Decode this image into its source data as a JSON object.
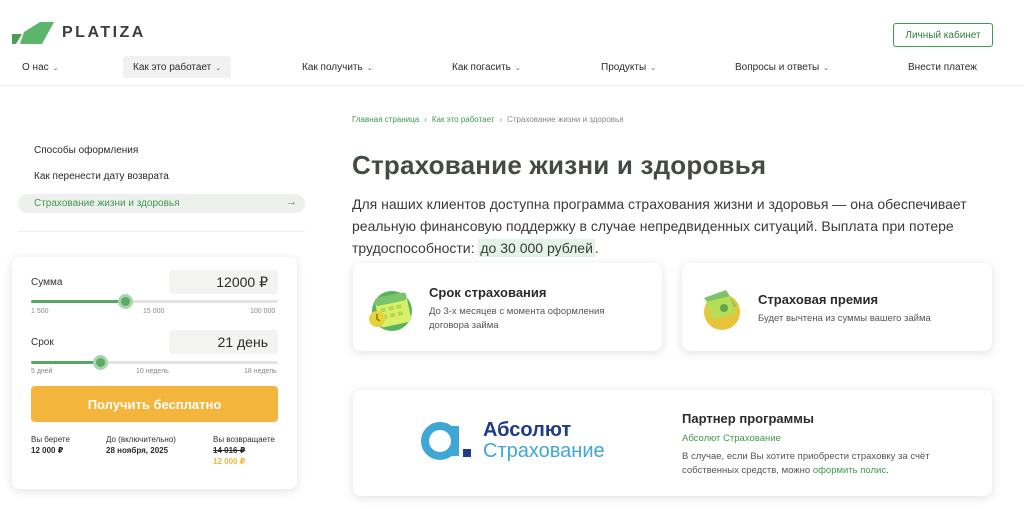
{
  "header": {
    "logo_text": "PLATIZA",
    "cabinet_button": "Личный кабинет",
    "colors": {
      "brand_green": "#3d9a4f",
      "accent_orange": "#f4b53d"
    }
  },
  "nav": {
    "items": [
      {
        "label": "О нас"
      },
      {
        "label": "Как это работает"
      },
      {
        "label": "Как получить"
      },
      {
        "label": "Как погасить"
      },
      {
        "label": "Продукты"
      },
      {
        "label": "Вопросы и ответы"
      },
      {
        "label": "Внести платеж"
      }
    ]
  },
  "sidebar": {
    "items": [
      {
        "label": "Способы оформления"
      },
      {
        "label": "Как перенести дату возврата"
      },
      {
        "label": "Страхование жизни и здоровья"
      }
    ]
  },
  "calculator": {
    "amount_label": "Сумма",
    "amount_value": "12000 ₽",
    "amount_fraction": 0.38,
    "amount_ticks": [
      "1 500",
      "15 000",
      "100 000"
    ],
    "term_label": "Срок",
    "term_value": "21 день",
    "term_fraction": 0.28,
    "term_ticks": [
      "5 дней",
      "10 недель",
      "18 недель"
    ],
    "cta_label": "Получить бесплатно",
    "summary": {
      "take_label": "Вы берете",
      "take_value": "12 000 ₽",
      "until_label": "До (включительно)",
      "until_value": "28 ноября, 2025",
      "return_label": "Вы возвращаете",
      "return_old": "14 016 ₽",
      "return_new": "12 000 ₽"
    }
  },
  "breadcrumbs": {
    "home": "Главная страница",
    "section": "Как это работает",
    "current": "Страхование жизни и здоровья",
    "sep": "›"
  },
  "main": {
    "title": "Страхование жизни и здоровья",
    "lead": "Для наших клиентов доступна программа страхования жизни и здоровья — она обеспечивает реальную финансовую поддержку в случае непредвиденных ситуаций. Выплата при потере трудоспособности: ",
    "lead_highlight": "до 30 000 рублей",
    "lead_end": "."
  },
  "cards": {
    "term": {
      "title": "Срок страхования",
      "text": "До 3-х месяцев с момента оформления договора займа",
      "icon": "calendar-icon"
    },
    "premium": {
      "title": "Страховая премия",
      "text": "Будет вычтена из суммы вашего займа",
      "icon": "wallet-icon"
    }
  },
  "partner": {
    "logo_line1": "Абсолют",
    "logo_line2": "Страхование",
    "title": "Партнер программы",
    "name": "Абсолют Страхование",
    "text": "В случае, если Вы хотите приобрести страховку за счёт собственных средств, можно ",
    "link": "оформить полис",
    "text_end": "."
  }
}
